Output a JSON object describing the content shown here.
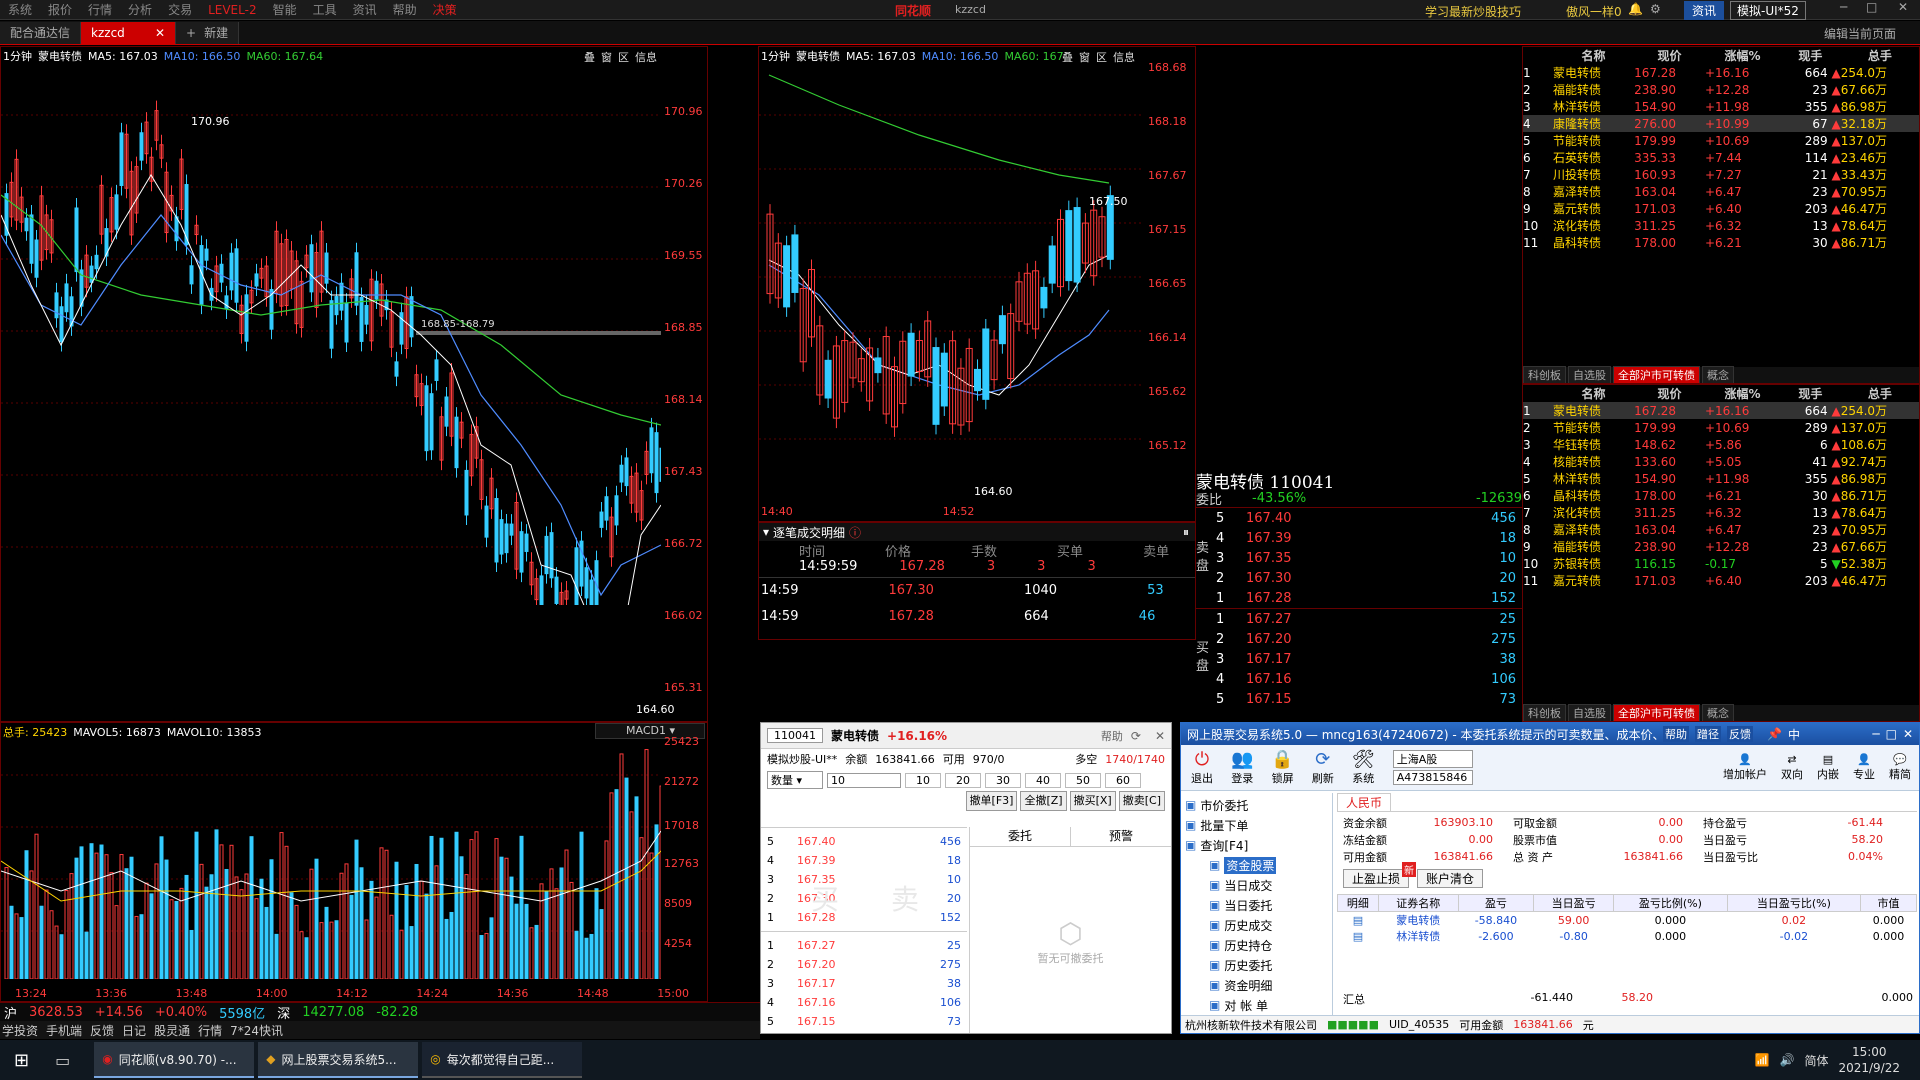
{
  "topmenu": {
    "items": [
      "系统",
      "报价",
      "行情",
      "分析",
      "交易",
      "LEVEL-2",
      "智能",
      "工具",
      "资讯",
      "帮助",
      "决策"
    ],
    "brand": "同花顺",
    "search": "kzzcd",
    "right_links": [
      "学习最新炒股技巧",
      "傲风一样0"
    ],
    "news_btn": "资讯",
    "account_btn": "模拟-UI*52"
  },
  "tabs": [
    {
      "label": "配合通达信"
    },
    {
      "label": "kzzcd"
    },
    {
      "label": "新建"
    }
  ],
  "edit_page": "编辑当前页面",
  "icons": {
    "close": "close-icon",
    "plus": "plus-icon",
    "bell": "bell-icon",
    "gear": "gear-icon",
    "windows": "windows-icon"
  },
  "chart1": {
    "period": "1分钟",
    "name": "蒙电转债",
    "ma5": "MA5: 167.03",
    "ma10": "MA10: 166.50",
    "ma60": "MA60: 167.64",
    "btns": [
      "叠",
      "窗",
      "区",
      "信息"
    ],
    "yticks": [
      "170.96",
      "170.26",
      "169.55",
      "168.85",
      "168.14",
      "167.43",
      "166.72",
      "166.02",
      "165.31"
    ],
    "high_label": "170.96",
    "low_label": "164.60",
    "range_label": "168.85-168.79",
    "vol_hdr": {
      "total": "总手: 25423",
      "mavol5": "MAVOL5: 16873",
      "mavol10": "MAVOL10: 13853",
      "sel": "MACD1"
    },
    "vol_yticks": [
      "25423",
      "21272",
      "17018",
      "12763",
      "8509",
      "4254"
    ],
    "xticks": [
      "13:24",
      "13:36",
      "13:48",
      "14:00",
      "14:12",
      "14:24",
      "14:36",
      "14:48",
      "15:00"
    ]
  },
  "chart2": {
    "period": "1分钟",
    "name": "蒙电转债",
    "ma5": "MA5: 167.03",
    "ma10": "MA10: 166.50",
    "ma60": "MA60: 167",
    "btns": [
      "叠",
      "窗",
      "区",
      "信息"
    ],
    "yticks": [
      "168.68",
      "168.18",
      "167.67",
      "167.15",
      "166.65",
      "166.14",
      "165.62",
      "165.12"
    ],
    "high_label": "167.50",
    "low_label": "164.60",
    "xticks": [
      "14:40",
      "14:52"
    ]
  },
  "tick_detail": {
    "title": "逐笔成交明细",
    "headers": [
      "时间",
      "价格",
      "手数",
      "买单",
      "卖单"
    ],
    "first": {
      "time": "14:59:59",
      "price": "167.28",
      "qty": "3",
      "buy": "3",
      "sell": "3"
    },
    "rows": [
      {
        "time": "14:59",
        "price": "167.30",
        "vol": "1040",
        "n": "53"
      },
      {
        "time": "14:59",
        "price": "167.28",
        "vol": "664",
        "n": "46"
      }
    ]
  },
  "quote": {
    "title": "蒙电转债 110041",
    "webi_label": "委比",
    "webi": "-43.56%",
    "webi_diff": "-12639",
    "sell": [
      {
        "n": "5",
        "p": "167.40",
        "v": "456"
      },
      {
        "n": "4",
        "p": "167.39",
        "v": "18"
      },
      {
        "n": "3",
        "p": "167.35",
        "v": "10"
      },
      {
        "n": "2",
        "p": "167.30",
        "v": "20"
      },
      {
        "n": "1",
        "p": "167.28",
        "v": "152"
      }
    ],
    "buy": [
      {
        "n": "1",
        "p": "167.27",
        "v": "25"
      },
      {
        "n": "2",
        "p": "167.20",
        "v": "275"
      },
      {
        "n": "3",
        "p": "167.17",
        "v": "38"
      },
      {
        "n": "4",
        "p": "167.16",
        "v": "106"
      },
      {
        "n": "5",
        "p": "167.15",
        "v": "73"
      }
    ],
    "sell_label": "卖盘",
    "buy_label": "买盘"
  },
  "rank_headers": [
    "名称",
    "现价",
    "涨幅%",
    "现手",
    "总手"
  ],
  "rank1": [
    {
      "i": "1",
      "name": "蒙电转债",
      "price": "167.28",
      "pct": "+16.16",
      "hand": "664",
      "total": "254.0万",
      "up": true
    },
    {
      "i": "2",
      "name": "福能转债",
      "price": "238.90",
      "pct": "+12.28",
      "hand": "23",
      "total": "67.66万",
      "up": true
    },
    {
      "i": "3",
      "name": "林洋转债",
      "price": "154.90",
      "pct": "+11.98",
      "hand": "355",
      "total": "86.98万",
      "up": true
    },
    {
      "i": "4",
      "name": "康隆转债",
      "price": "276.00",
      "pct": "+10.99",
      "hand": "67",
      "total": "32.18万",
      "up": true
    },
    {
      "i": "5",
      "name": "节能转债",
      "price": "179.99",
      "pct": "+10.69",
      "hand": "289",
      "total": "137.0万",
      "up": true
    },
    {
      "i": "6",
      "name": "石英转债",
      "price": "335.33",
      "pct": "+7.44",
      "hand": "114",
      "total": "23.46万",
      "up": true
    },
    {
      "i": "7",
      "name": "川投转债",
      "price": "160.93",
      "pct": "+7.27",
      "hand": "21",
      "total": "33.43万",
      "up": true
    },
    {
      "i": "8",
      "name": "嘉泽转债",
      "price": "163.04",
      "pct": "+6.47",
      "hand": "23",
      "total": "70.95万",
      "up": true
    },
    {
      "i": "9",
      "name": "嘉元转债",
      "price": "171.03",
      "pct": "+6.40",
      "hand": "203",
      "total": "46.47万",
      "up": true
    },
    {
      "i": "10",
      "name": "滨化转债",
      "price": "311.25",
      "pct": "+6.32",
      "hand": "13",
      "total": "78.64万",
      "up": true
    },
    {
      "i": "11",
      "name": "晶科转债",
      "price": "178.00",
      "pct": "+6.21",
      "hand": "30",
      "total": "86.71万",
      "up": true
    }
  ],
  "rank_tabs": [
    "科创板",
    "自选股",
    "全部沪市可转债",
    "概念"
  ],
  "rank2": [
    {
      "i": "1",
      "name": "蒙电转债",
      "price": "167.28",
      "pct": "+16.16",
      "hand": "664",
      "total": "254.0万",
      "up": true
    },
    {
      "i": "2",
      "name": "节能转债",
      "price": "179.99",
      "pct": "+10.69",
      "hand": "289",
      "total": "137.0万",
      "up": true
    },
    {
      "i": "3",
      "name": "华钰转债",
      "price": "148.62",
      "pct": "+5.86",
      "hand": "6",
      "total": "108.6万",
      "up": true
    },
    {
      "i": "4",
      "name": "核能转债",
      "price": "133.60",
      "pct": "+5.05",
      "hand": "41",
      "total": "92.74万",
      "up": true
    },
    {
      "i": "5",
      "name": "林洋转债",
      "price": "154.90",
      "pct": "+11.98",
      "hand": "355",
      "total": "86.98万",
      "up": true
    },
    {
      "i": "6",
      "name": "晶科转债",
      "price": "178.00",
      "pct": "+6.21",
      "hand": "30",
      "total": "86.71万",
      "up": true
    },
    {
      "i": "7",
      "name": "滨化转债",
      "price": "311.25",
      "pct": "+6.32",
      "hand": "13",
      "total": "78.64万",
      "up": true
    },
    {
      "i": "8",
      "name": "嘉泽转债",
      "price": "163.04",
      "pct": "+6.47",
      "hand": "23",
      "total": "70.95万",
      "up": true
    },
    {
      "i": "9",
      "name": "福能转债",
      "price": "238.90",
      "pct": "+12.28",
      "hand": "23",
      "total": "67.66万",
      "up": true
    },
    {
      "i": "10",
      "name": "苏银转债",
      "price": "116.15",
      "pct": "-0.17",
      "hand": "5",
      "total": "52.38万",
      "up": false
    },
    {
      "i": "11",
      "name": "嘉元转债",
      "price": "171.03",
      "pct": "+6.40",
      "hand": "203",
      "total": "46.47万",
      "up": true
    }
  ],
  "order": {
    "code": "110041",
    "name": "蒙电转债",
    "pct": "+16.16%",
    "help": "帮助",
    "account": "模拟炒股-UI**",
    "balance_label": "余额",
    "balance": "163841.66",
    "avail_label": "可用",
    "avail": "970/0",
    "multi_label": "多空",
    "multi": "1740/1740",
    "qty_label": "数量",
    "qty": "10",
    "presets": [
      "10",
      "20",
      "30",
      "40",
      "50",
      "60"
    ],
    "btns": [
      "撤单[F3]",
      "全撤[Z]",
      "撤买[X]",
      "撤卖[C]"
    ],
    "tab_entrust": "委托",
    "tab_warn": "预警",
    "buy_wm": "买",
    "sell_wm": "卖",
    "empty": "暂无可撤委托"
  },
  "status": {
    "sh_label": "沪",
    "sh_val": "3628.53",
    "sh_chg": "+14.56",
    "sh_pct": "+0.40%",
    "sh_amt": "5598亿",
    "sz_label": "深",
    "sz_val": "14277.08",
    "sz_chg": "-82.28",
    "tabs": [
      "学投资",
      "手机端",
      "反馈",
      "日记",
      "股灵通",
      "行情",
      "7*24快讯"
    ]
  },
  "trade": {
    "title": "网上股票交易系统5.0 — mncg163(47240672) - 本委托系统提示的可卖数量、成本价、盈亏等信息",
    "title_btns": [
      "帮助",
      "蹭径",
      "反馈"
    ],
    "ime": "中",
    "tools": [
      "退出",
      "登录",
      "锁屏",
      "刷新",
      "系统"
    ],
    "market": "上海A股",
    "account": "A473815846",
    "right_tools": [
      "增加帐户",
      "双向",
      "内嵌",
      "专业",
      "精简"
    ],
    "tree": [
      "市价委托",
      "批量下单",
      "查询[F4]",
      "资金股票",
      "当日成交",
      "当日委托",
      "历史成交",
      "历史持仓",
      "历史委托",
      "资金明细",
      "对 帐 单"
    ],
    "currency": "人民币",
    "funds": [
      {
        "l": "资金余额",
        "v": "163903.10",
        "l2": "可取金额",
        "v2": "0.00",
        "l3": "持仓盈亏",
        "v3": "-61.44"
      },
      {
        "l": "冻结金额",
        "v": "0.00",
        "l2": "股票市值",
        "v2": "0.00",
        "l3": "当日盈亏",
        "v3": "58.20"
      },
      {
        "l": "可用金额",
        "v": "163841.66",
        "l2": "总 资 产",
        "v2": "163841.66",
        "l3": "当日盈亏比",
        "v3": "0.04%"
      }
    ],
    "stop_btn": "止盈止损",
    "new_badge": "新",
    "clear_btn": "账户清仓",
    "cols": [
      "明细",
      "证券名称",
      "盈亏",
      "当日盈亏",
      "盈亏比例(%)",
      "当日盈亏比(%)",
      "市值"
    ],
    "rows": [
      {
        "name": "蒙电转债",
        "pl": "-58.840",
        "dpl": "59.00",
        "r": "0.000",
        "dr": "0.02",
        "mv": "0.000"
      },
      {
        "name": "林洋转债",
        "pl": "-2.600",
        "dpl": "-0.80",
        "r": "0.000",
        "dr": "-0.02",
        "mv": "0.000"
      }
    ],
    "total_label": "汇总",
    "total_pl": "-61.440",
    "total_dpl": "58.20",
    "total_mv": "0.000",
    "footer_co": "杭州核新软件技术有限公司",
    "footer_uid": "UID_40535",
    "footer_avail_label": "可用金额",
    "footer_avail": "163841.66",
    "footer_unit": "元"
  },
  "taskbar": {
    "items": [
      "同花顺(v8.90.70) -...",
      "网上股票交易系统5...",
      "每次都觉得自己距..."
    ],
    "ime": "简体",
    "time": "15:00",
    "date": "2021/9/22"
  }
}
